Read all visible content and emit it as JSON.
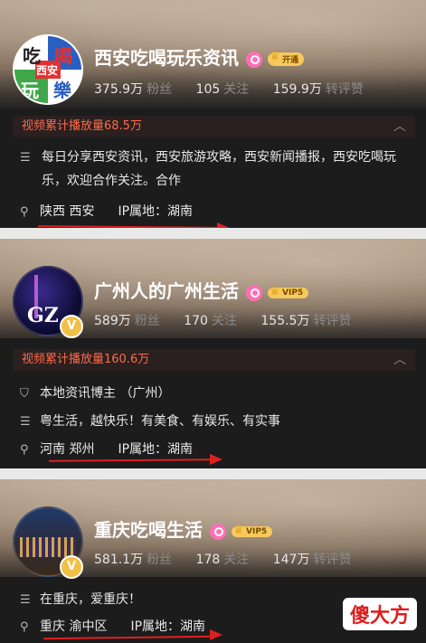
{
  "cards": [
    {
      "name": "西安吃喝玩乐资讯",
      "badge": "开通",
      "fans": "375.9万",
      "fans_label": "粉丝",
      "follow": "105",
      "follow_label": "关注",
      "likes": "159.9万",
      "likes_label": "转评赞",
      "play": "视频累计播放量68.5万",
      "desc": "每日分享西安资讯，西安旅游攻略，西安新闻播报，西安吃喝玩乐，欢迎合作关注。合作",
      "location": "陕西 西安",
      "ip": "IP属地：湖南",
      "avatar_chars": [
        "吃",
        "喝",
        "玩",
        "樂",
        "西安"
      ]
    },
    {
      "name": "广州人的广州生活",
      "badge": "VIP5",
      "fans": "589万",
      "fans_label": "粉丝",
      "follow": "170",
      "follow_label": "关注",
      "likes": "155.5万",
      "likes_label": "转评赞",
      "play": "视频累计播放量160.6万",
      "verify": "本地资讯博主 （广州）",
      "desc": "粤生活，越快乐！有美食、有娱乐、有实事",
      "location": "河南 郑州",
      "ip": "IP属地：湖南",
      "avatar_text": "GZ"
    },
    {
      "name": "重庆吃喝生活",
      "badge": "VIP5",
      "fans": "581.1万",
      "fans_label": "粉丝",
      "follow": "178",
      "follow_label": "关注",
      "likes": "147万",
      "likes_label": "转评赞",
      "desc": "在重庆，爱重庆！",
      "location": "重庆 渝中区",
      "ip": "IP属地：湖南"
    }
  ],
  "verified_mark": "V",
  "watermark": "傻大方"
}
